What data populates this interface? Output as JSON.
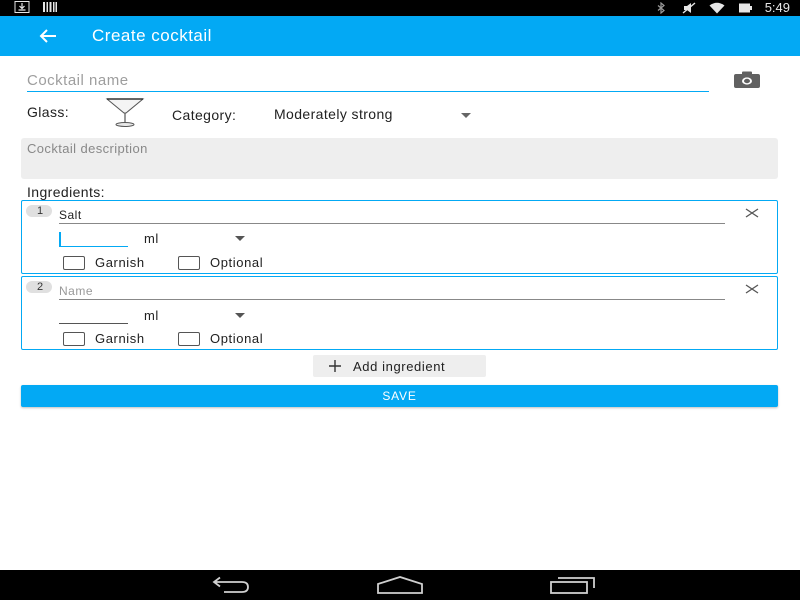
{
  "status_bar": {
    "time": "5:49",
    "left_icons": [
      "download-icon",
      "barcode-icon"
    ],
    "right_icons": [
      "bluetooth-icon",
      "mute-icon",
      "wifi-icon",
      "battery-icon"
    ]
  },
  "app_bar": {
    "title": "Create cocktail",
    "color": "#03a9f4",
    "back_icon": "arrow-left-icon"
  },
  "form": {
    "name_placeholder": "Cocktail name",
    "name_value": "",
    "camera_icon": "camera-icon",
    "glass_label": "Glass:",
    "glass_icon": "cocktail-glass-icon",
    "category_label": "Category:",
    "category_value": "Moderately strong",
    "description_placeholder": "Cocktail description",
    "ingredients_label": "Ingredients:"
  },
  "ingredients": [
    {
      "number": "1",
      "name_value": "Salt",
      "name_placeholder": "Name",
      "amount_value": "",
      "unit": "ml",
      "garnish_label": "Garnish",
      "garnish_checked": false,
      "optional_label": "Optional",
      "optional_checked": false
    },
    {
      "number": "2",
      "name_value": "",
      "name_placeholder": "Name",
      "amount_value": "",
      "unit": "ml",
      "garnish_label": "Garnish",
      "garnish_checked": false,
      "optional_label": "Optional",
      "optional_checked": false
    }
  ],
  "actions": {
    "add_ingredient_label": "Add ingredient",
    "save_label": "SAVE"
  },
  "nav_bar": {
    "icons": [
      "back-nav-icon",
      "home-nav-icon",
      "recents-nav-icon"
    ]
  }
}
